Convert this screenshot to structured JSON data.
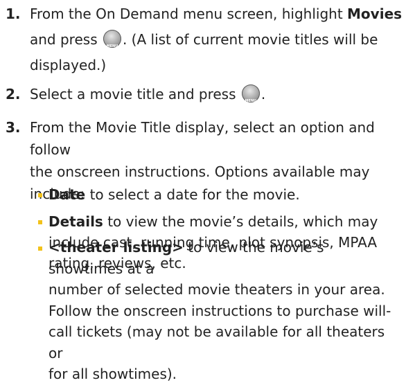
{
  "steps": [
    {
      "num": "1.",
      "line1_pre": "From the On Demand menu screen, highlight ",
      "line1_bold": "Movies",
      "line2_pre": "and press ",
      "line2_post": ". (A list of current movie titles will be",
      "line3": "displayed.)"
    },
    {
      "num": "2.",
      "pre": "Select a movie title and press ",
      "post": "."
    },
    {
      "num": "3.",
      "line1": "From the Movie Title display, select an option and follow",
      "line2": "the onscreen instructions. Options available may",
      "line3": "include:"
    }
  ],
  "options": [
    {
      "bold": "Date",
      "lines": [
        " to select a date for the movie."
      ]
    },
    {
      "bold": "Details",
      "lines": [
        " to view the movie’s details, which may",
        "include cast, running time, plot synopsis, MPAA",
        "rating, reviews, etc."
      ]
    },
    {
      "bold": "<theater listing>",
      "lines": [
        " to view the movie’s showtimes at a",
        "number of selected movie theaters in your area.",
        "Follow the onscreen instructions to purchase will-",
        "call tickets (may not be available for all theaters or",
        "for all showtimes)."
      ]
    }
  ],
  "icons": {
    "ok_button": "menu-ok-button-icon"
  },
  "colors": {
    "bullet": "#f2c21b",
    "text": "#222222"
  }
}
